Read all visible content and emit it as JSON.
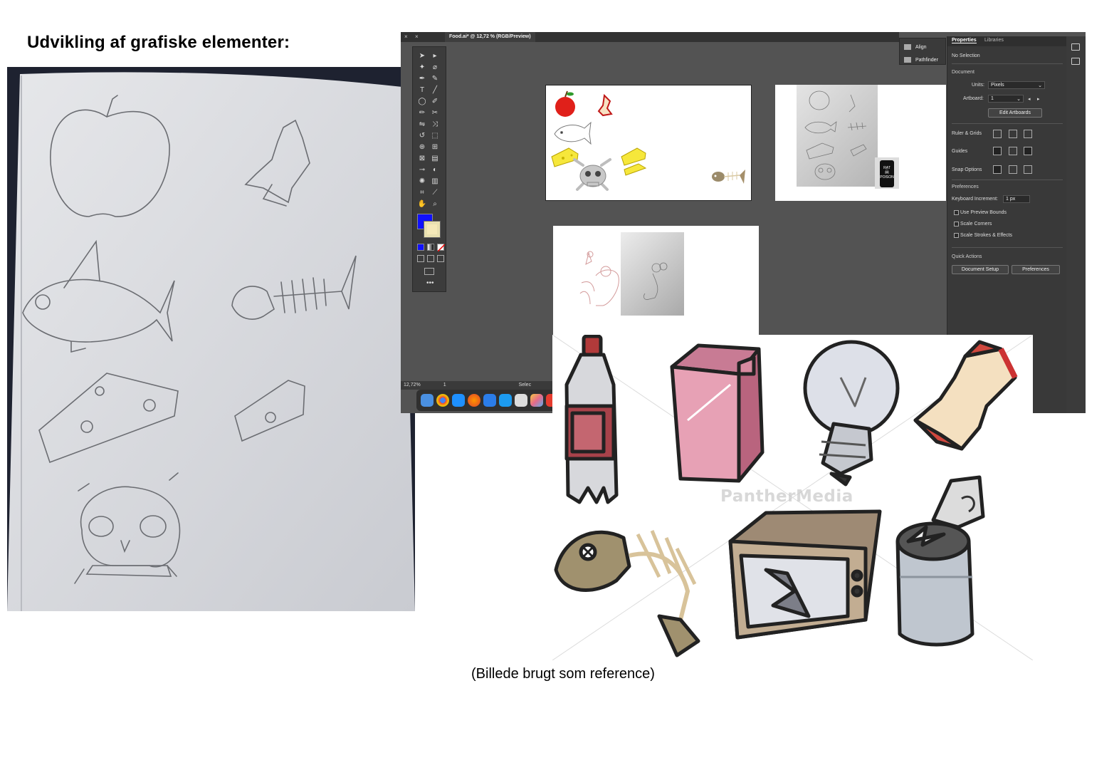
{
  "slide": {
    "title": "Udvikling af grafiske elementer:",
    "caption": "(Billede brugt som reference)"
  },
  "illustrator": {
    "doc_tab": "Food.ai* @ 12,72 % (RGB/Preview)",
    "zoom": "12,72%",
    "artboard_number": "1",
    "status_tool": "Selec",
    "fill_color": "#1010ff",
    "stroke_color": "#f5e9b8",
    "float_panel": {
      "align": "Align",
      "pathfinder": "Pathfinder"
    },
    "properties": {
      "tab_properties": "Properties",
      "tab_libraries": "Libraries",
      "selection": "No Selection",
      "document_header": "Document",
      "units_label": "Units:",
      "units_value": "Pixels",
      "artboard_label": "Artboard:",
      "artboard_value": "1",
      "edit_artboards": "Edit Artboards",
      "ruler_grids": "Ruler & Grids",
      "guides": "Guides",
      "snap_options": "Snap Options",
      "preferences_header": "Preferences",
      "keyboard_increment_label": "Keyboard Increment:",
      "keyboard_increment_value": "1 px",
      "use_preview_bounds": "Use Preview Bounds",
      "scale_corners": "Scale Corners",
      "scale_strokes": "Scale Strokes & Effects",
      "quick_actions": "Quick Actions",
      "document_setup": "Document Setup",
      "preferences_button": "Preferences"
    },
    "artboard2_label_line1": "RAT",
    "artboard2_label_line2": "POISON"
  },
  "reference": {
    "watermark": "PantherMedia"
  }
}
